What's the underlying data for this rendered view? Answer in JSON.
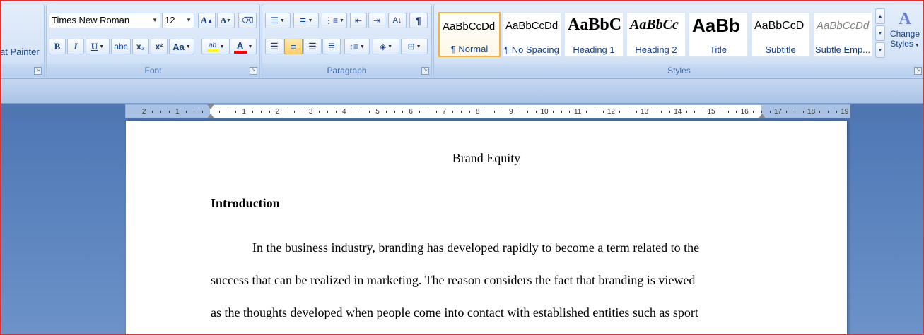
{
  "clipboard": {
    "format_painter_label": "at Painter"
  },
  "font": {
    "group_label": "Font",
    "family_value": "Times New Roman",
    "size_value": "12",
    "grow_label": "A",
    "shrink_label": "A",
    "bold_label": "B",
    "italic_label": "I",
    "underline_label": "U",
    "strike_label": "abc",
    "subscript_label": "x₂",
    "superscript_label": "x²",
    "case_label": "Aa",
    "highlight_label": "ab",
    "color_label": "A",
    "highlight_color": "#ffff00",
    "font_color": "#ff0000"
  },
  "paragraph": {
    "group_label": "Paragraph",
    "pilcrow": "¶"
  },
  "styles": {
    "group_label": "Styles",
    "tiles": [
      {
        "sample": "AaBbCcDd",
        "name": "¶ Normal"
      },
      {
        "sample": "AaBbCcDd",
        "name": "¶ No Spacing"
      },
      {
        "sample": "AaBbC",
        "name": "Heading 1"
      },
      {
        "sample": "AaBbCc",
        "name": "Heading 2"
      },
      {
        "sample": "AaBb",
        "name": "Title"
      },
      {
        "sample": "AaBbCcD",
        "name": "Subtitle"
      },
      {
        "sample": "AaBbCcDd",
        "name": "Subtle Emp..."
      }
    ],
    "change_label_1": "Change",
    "change_label_2": "Styles"
  },
  "ruler": {
    "left_ticks": [
      "2",
      "1"
    ],
    "right_ticks": [
      "1",
      "2",
      "3",
      "4",
      "5",
      "6",
      "7",
      "8",
      "9",
      "10",
      "11",
      "12",
      "13",
      "14",
      "15",
      "16",
      "17",
      "18",
      "19"
    ]
  },
  "document": {
    "title": "Brand Equity",
    "heading": "Introduction",
    "lines": [
      "In the business industry, branding has developed rapidly to become a term related to the",
      "success that can be realized in marketing. The reason considers the fact that branding is viewed",
      "as the thoughts developed when people come into contact with established entities such as sport"
    ]
  },
  "colors": {
    "selected_style_border": "#f2b33d",
    "frame_border": "#e0312c"
  }
}
